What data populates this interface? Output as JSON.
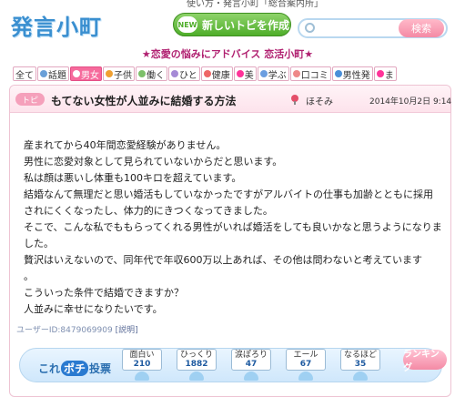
{
  "top_links": "使い方・発言小町「総合案内所」",
  "logo": "発言小町",
  "new_topic": {
    "badge": "NEW",
    "label": "新しいトピを作成"
  },
  "search": {
    "placeholder": "",
    "button": "検索"
  },
  "tagline": "★恋愛の悩みにアドバイス 恋活小町★",
  "categories": [
    {
      "label": "全て",
      "color": ""
    },
    {
      "label": "話題",
      "color": "#6aa0d8"
    },
    {
      "label": "男女",
      "color": "#ffffff",
      "active": true
    },
    {
      "label": "子供",
      "color": "#f0a030"
    },
    {
      "label": "働く",
      "color": "#7cc06a"
    },
    {
      "label": "ひと",
      "color": "#a58ad6"
    },
    {
      "label": "健康",
      "color": "#e66"
    },
    {
      "label": "美",
      "color": "#f39"
    },
    {
      "label": "学ぶ",
      "color": "#6b9ee0"
    },
    {
      "label": "口コミ",
      "color": "#e88"
    },
    {
      "label": "男性発",
      "color": "#4a8fd8"
    },
    {
      "label": "ま",
      "color": "#f39"
    }
  ],
  "topic": {
    "tag": "トピ",
    "title": "もてない女性が人並みに結婚する方法",
    "author": "ほそみ",
    "date": "2014年10月2日 9:14",
    "body": [
      "産まれてから40年間恋愛経験がありません。",
      "男性に恋愛対象として見られていないからだと思います。",
      "私は顔は悪いし体重も100キロを超えています。",
      "結婚なんて無理だと思い婚活もしていなかったですがアルバイトの仕事も加齢とともに採用",
      "されにくくなったし、体力的にきつくなってきました。",
      "そこで、こんな私でももらってくれる男性がいれば婚活をしても良いかなと思うようになりま",
      "した。",
      "贅沢はいえないので、同年代で年収600万以上あれば、その他は問わないと考えています",
      "。",
      "こういった条件で結婚できますか？",
      "人並みに幸せになりたいです。"
    ],
    "user_id": "ユーザーID:8479069909",
    "user_id_help": "[説明]"
  },
  "vote": {
    "label_prefix": "これ",
    "label_pochi": "ポチ",
    "label_suffix": "投票",
    "buttons": [
      {
        "label": "面白い",
        "count": "210"
      },
      {
        "label": "ひっくり",
        "count": "1882"
      },
      {
        "label": "涙ぽろり",
        "count": "47"
      },
      {
        "label": "エール",
        "count": "67"
      },
      {
        "label": "なるほど",
        "count": "35"
      }
    ],
    "ranking": "ランキング"
  }
}
